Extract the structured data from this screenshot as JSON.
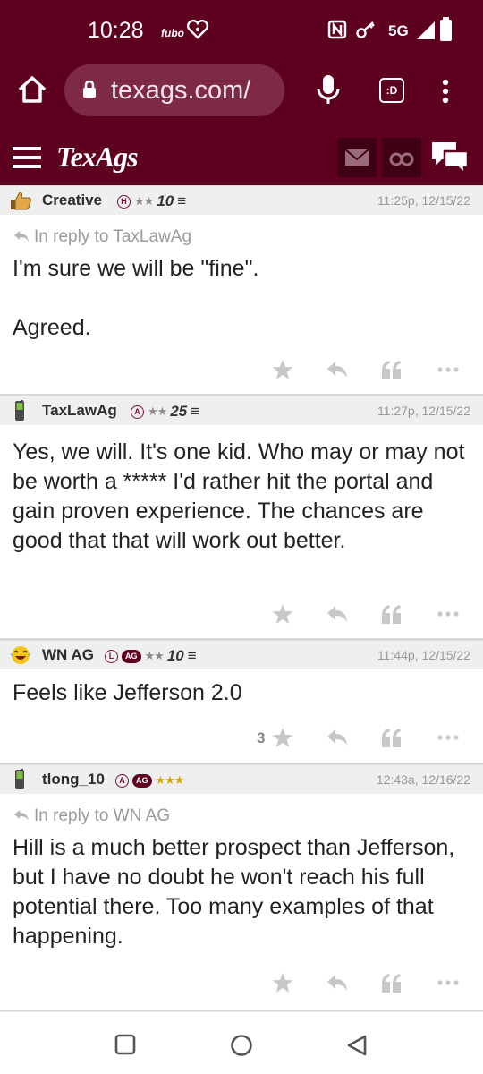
{
  "status": {
    "time": "10:28",
    "app_badge": "fubo",
    "network": "5G"
  },
  "browser": {
    "url": "texags.com/",
    "tabs_label": ":D"
  },
  "site": {
    "logo": "TexAgs"
  },
  "posts": [
    {
      "username": "Creative",
      "badges": [
        "H"
      ],
      "stars": "★★",
      "level": "10",
      "time": "11:25p, 12/15/22",
      "reply_to": "In reply to TaxLawAg",
      "body": [
        "I'm sure we will be \"fine\".",
        "",
        "Agreed."
      ],
      "star_count": ""
    },
    {
      "username": "TaxLawAg",
      "badges": [
        "A"
      ],
      "stars": "★★",
      "level": "25",
      "time": "11:27p, 12/15/22",
      "reply_to": "",
      "body": [
        "Yes, we will. It's one kid. Who may or may not be worth a ***** I'd rather hit the portal and gain proven experience. The chances are good that that will work out better."
      ],
      "star_count": ""
    },
    {
      "username": "WN AG",
      "badges": [
        "L",
        "AG"
      ],
      "stars": "★★",
      "level": "10",
      "time": "11:44p, 12/15/22",
      "reply_to": "",
      "body": [
        "Feels like Jefferson 2.0"
      ],
      "star_count": "3"
    },
    {
      "username": "tlong_10",
      "badges": [
        "A",
        "AG"
      ],
      "stars": "★★★",
      "level": "",
      "time": "12:43a, 12/16/22",
      "reply_to": "In reply to WN AG",
      "body": [
        "Hill is a much better prospect than Jefferson, but I have no doubt he won't reach his full potential there. Too many examples of that happening."
      ],
      "star_count": ""
    }
  ],
  "colors": {
    "maroon": "#5e0022",
    "gold_star": "#d6a800"
  },
  "icons": {
    "avatars": [
      "thumbs-up-icon",
      "phone-icon",
      "laughing-emoji-icon",
      "phone-icon"
    ],
    "actions": [
      "star-icon",
      "reply-icon",
      "quote-icon",
      "more-icon"
    ]
  }
}
